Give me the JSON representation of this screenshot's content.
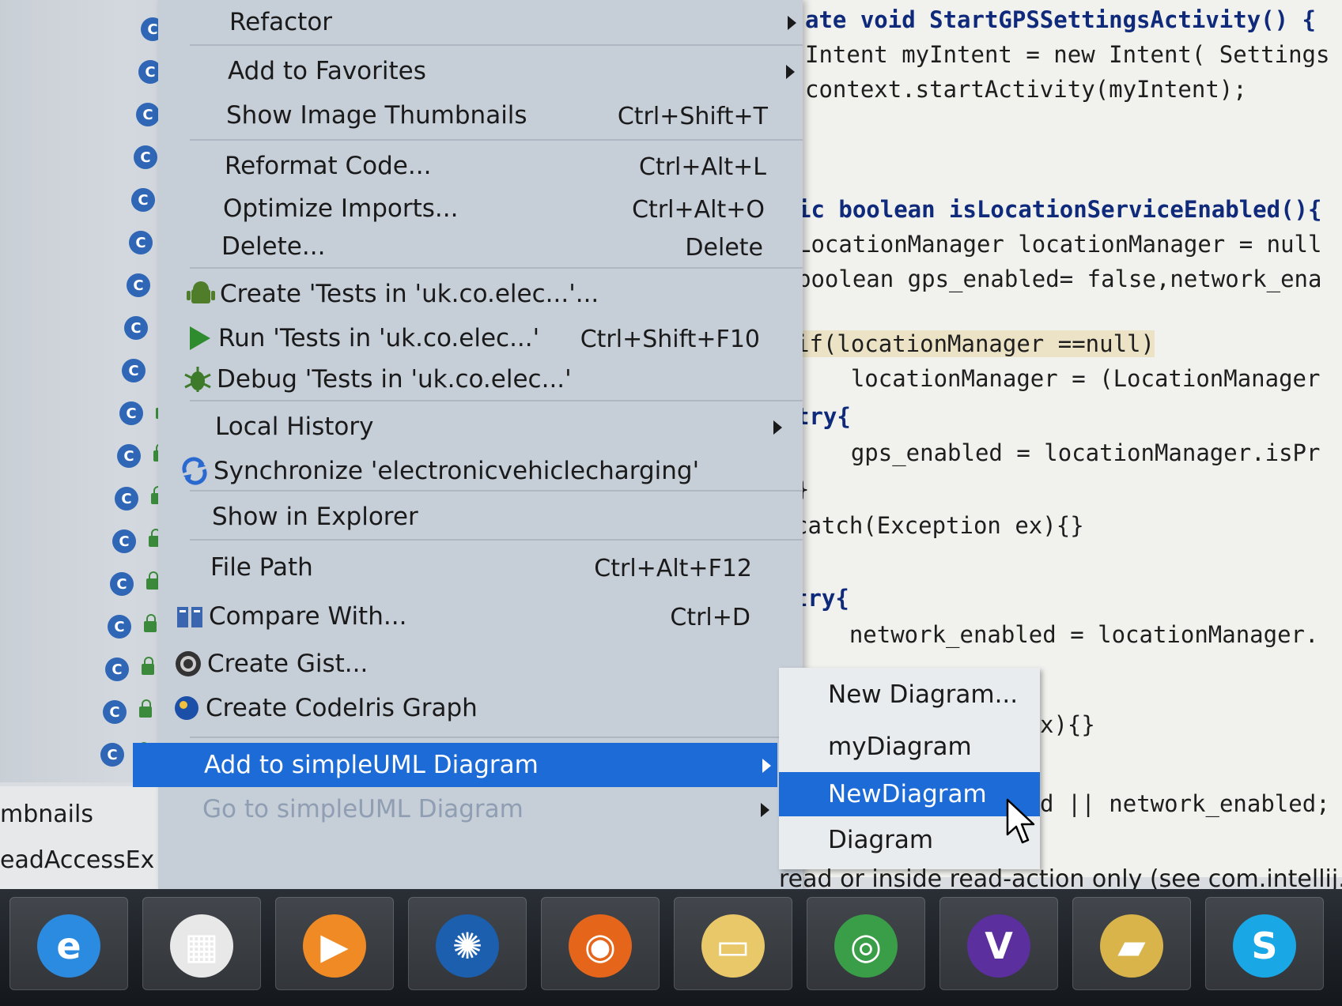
{
  "context_menu": {
    "items": [
      {
        "label": "Refactor",
        "shortcut": "",
        "submenu": true,
        "icon": ""
      },
      {
        "label": "Add to Favorites",
        "shortcut": "",
        "submenu": true,
        "icon": ""
      },
      {
        "label": "Show Image Thumbnails",
        "shortcut": "Ctrl+Shift+T",
        "submenu": false,
        "icon": ""
      },
      {
        "label": "Reformat Code...",
        "shortcut": "Ctrl+Alt+L",
        "submenu": false,
        "icon": ""
      },
      {
        "label": "Optimize Imports...",
        "shortcut": "Ctrl+Alt+O",
        "submenu": false,
        "icon": ""
      },
      {
        "label": "Delete...",
        "shortcut": "Delete",
        "submenu": false,
        "icon": ""
      },
      {
        "label": "Create 'Tests in 'uk.co.elec...'...",
        "shortcut": "",
        "submenu": false,
        "icon": "android-icon"
      },
      {
        "label": "Run 'Tests in 'uk.co.elec...'",
        "shortcut": "Ctrl+Shift+F10",
        "submenu": false,
        "icon": "run-icon"
      },
      {
        "label": "Debug 'Tests in 'uk.co.elec...'",
        "shortcut": "",
        "submenu": false,
        "icon": "debug-icon"
      },
      {
        "label": "Local History",
        "shortcut": "",
        "submenu": true,
        "icon": ""
      },
      {
        "label": "Synchronize 'electronicvehiclecharging'",
        "shortcut": "",
        "submenu": false,
        "icon": "sync-icon"
      },
      {
        "label": "Show in Explorer",
        "shortcut": "",
        "submenu": false,
        "icon": ""
      },
      {
        "label": "File Path",
        "shortcut": "Ctrl+Alt+F12",
        "submenu": false,
        "icon": ""
      },
      {
        "label": "Compare With...",
        "shortcut": "Ctrl+D",
        "submenu": false,
        "icon": "compare-icon"
      },
      {
        "label": "Create Gist...",
        "shortcut": "",
        "submenu": false,
        "icon": "github-icon"
      },
      {
        "label": "Create CodeIris Graph",
        "shortcut": "",
        "submenu": false,
        "icon": "codeiris-icon"
      },
      {
        "label": "Add to simpleUML Diagram",
        "shortcut": "",
        "submenu": true,
        "icon": "",
        "active": true
      },
      {
        "label": "Go to simpleUML Diagram",
        "shortcut": "",
        "submenu": true,
        "icon": "",
        "disabled": true
      }
    ]
  },
  "submenu": {
    "items": [
      {
        "label": "New Diagram..."
      },
      {
        "label": "myDiagram"
      },
      {
        "label": "NewDiagram",
        "selected": true
      },
      {
        "label": "Diagram"
      }
    ]
  },
  "code": {
    "line1": "ate void StartGPSSettingsActivity() {",
    "line2": "Intent myIntent = new Intent( Settings",
    "line3": "context.startActivity(myIntent);",
    "line4": "ic boolean isLocationServiceEnabled(){",
    "line5": "LocationManager locationManager = null",
    "line6": "boolean gps_enabled= false,network_ena",
    "line7": "if(locationManager ==null)",
    "line8": "    locationManager = (LocationManager",
    "line9": "try{",
    "line10": "    gps_enabled = locationManager.isPr",
    "line11": "}",
    "line12": "catch(Exception ex){}",
    "line13": "try{",
    "line14": "    network_enabled = locationManager.",
    "line15": "x){}",
    "line16": "d || network_enabled;"
  },
  "bottom_panel": {
    "tab1": "mbnails",
    "tab2": "eadAccessEx"
  },
  "status_message": "read or inside read-action only (see com.intellij.ope",
  "tree": {
    "node_icon_letter": "C",
    "rows": 18
  },
  "taskbar": {
    "apps": [
      {
        "name": "internet-explorer-icon",
        "glyph": "e",
        "color": "#2b8be0"
      },
      {
        "name": "start-tiles-icon",
        "glyph": "▦",
        "color": "#e8e8e8"
      },
      {
        "name": "media-player-icon",
        "glyph": "▶",
        "color": "#f08a24"
      },
      {
        "name": "codeiris-app-icon",
        "glyph": "✺",
        "color": "#1c5fae"
      },
      {
        "name": "firefox-icon",
        "glyph": "◉",
        "color": "#e5661a"
      },
      {
        "name": "file-explorer-icon",
        "glyph": "▭",
        "color": "#e9c869"
      },
      {
        "name": "chrome-icon",
        "glyph": "◎",
        "color": "#3a9d48"
      },
      {
        "name": "visual-studio-icon",
        "glyph": "V",
        "color": "#5b2f9e"
      },
      {
        "name": "folder-icon",
        "glyph": "▰",
        "color": "#d9b44a"
      },
      {
        "name": "skype-icon",
        "glyph": "S",
        "color": "#1aa7e6"
      }
    ]
  }
}
